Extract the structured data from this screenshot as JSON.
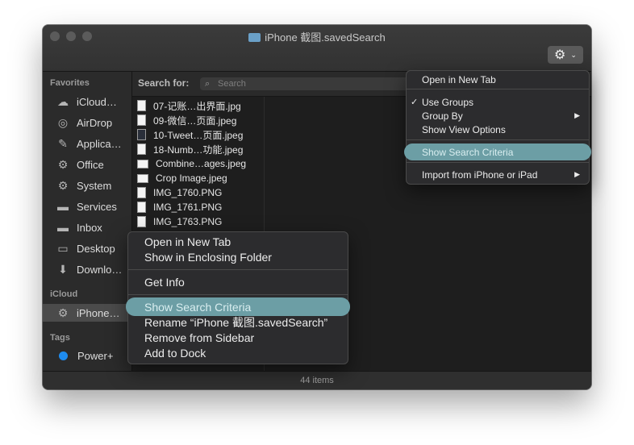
{
  "window": {
    "title": "iPhone 截图.savedSearch",
    "status": "44 items"
  },
  "toolbar": {
    "gear_label": "⚙",
    "gear_chevron": "⌄"
  },
  "sidebar": {
    "favorites_header": "Favorites",
    "favorites": [
      {
        "label": "iCloud…",
        "icon": "cloud-icon",
        "glyph": "☁"
      },
      {
        "label": "AirDrop",
        "icon": "airdrop-icon",
        "glyph": "◎"
      },
      {
        "label": "Applica…",
        "icon": "applications-icon",
        "glyph": "✎"
      },
      {
        "label": "Office",
        "icon": "gear-icon",
        "glyph": "⚙"
      },
      {
        "label": "System",
        "icon": "gear-icon",
        "glyph": "⚙"
      },
      {
        "label": "Services",
        "icon": "folder-icon",
        "glyph": "▬"
      },
      {
        "label": "Inbox",
        "icon": "folder-icon",
        "glyph": "▬"
      },
      {
        "label": "Desktop",
        "icon": "desktop-icon",
        "glyph": "▭"
      },
      {
        "label": "Downlo…",
        "icon": "downloads-icon",
        "glyph": "⬇"
      }
    ],
    "icloud_header": "iCloud",
    "icloud_items": [
      {
        "label": "iPhone…",
        "icon": "gear-icon",
        "glyph": "⚙"
      }
    ],
    "tags_header": "Tags",
    "tags": [
      {
        "label": "Power+",
        "color": "#1e8cf0"
      }
    ]
  },
  "search": {
    "label": "Search for:",
    "placeholder": "Search"
  },
  "files": [
    {
      "name": "07-记账…出界面.jpg"
    },
    {
      "name": "09-微信…页面.jpeg"
    },
    {
      "name": "10-Tweet…页面.jpeg"
    },
    {
      "name": "18-Numb…功能.jpeg"
    },
    {
      "name": "Combine…ages.jpeg"
    },
    {
      "name": "Crop Image.jpeg"
    },
    {
      "name": "IMG_1760.PNG"
    },
    {
      "name": "IMG_1761.PNG"
    },
    {
      "name": "IMG_1763.PNG"
    }
  ],
  "gear_menu": {
    "items": [
      {
        "label": "Open in New Tab"
      },
      {
        "label": "Use Groups",
        "checked": "✓"
      },
      {
        "label": "Group By",
        "arrow": "▶"
      },
      {
        "label": "Show View Options"
      },
      {
        "label": "Show Search Criteria"
      },
      {
        "label": "Import from iPhone or iPad",
        "arrow": "▶"
      }
    ]
  },
  "context_menu": {
    "items": [
      {
        "label": "Open in New Tab"
      },
      {
        "label": "Show in Enclosing Folder"
      },
      {
        "label": "Get Info"
      },
      {
        "label": "Show Search Criteria"
      },
      {
        "label": "Rename “iPhone 截图.savedSearch”"
      },
      {
        "label": "Remove from Sidebar"
      },
      {
        "label": "Add to Dock"
      }
    ]
  },
  "colors": {
    "highlight": "#6c9ea5",
    "tag_blue": "#1e8cf0"
  }
}
